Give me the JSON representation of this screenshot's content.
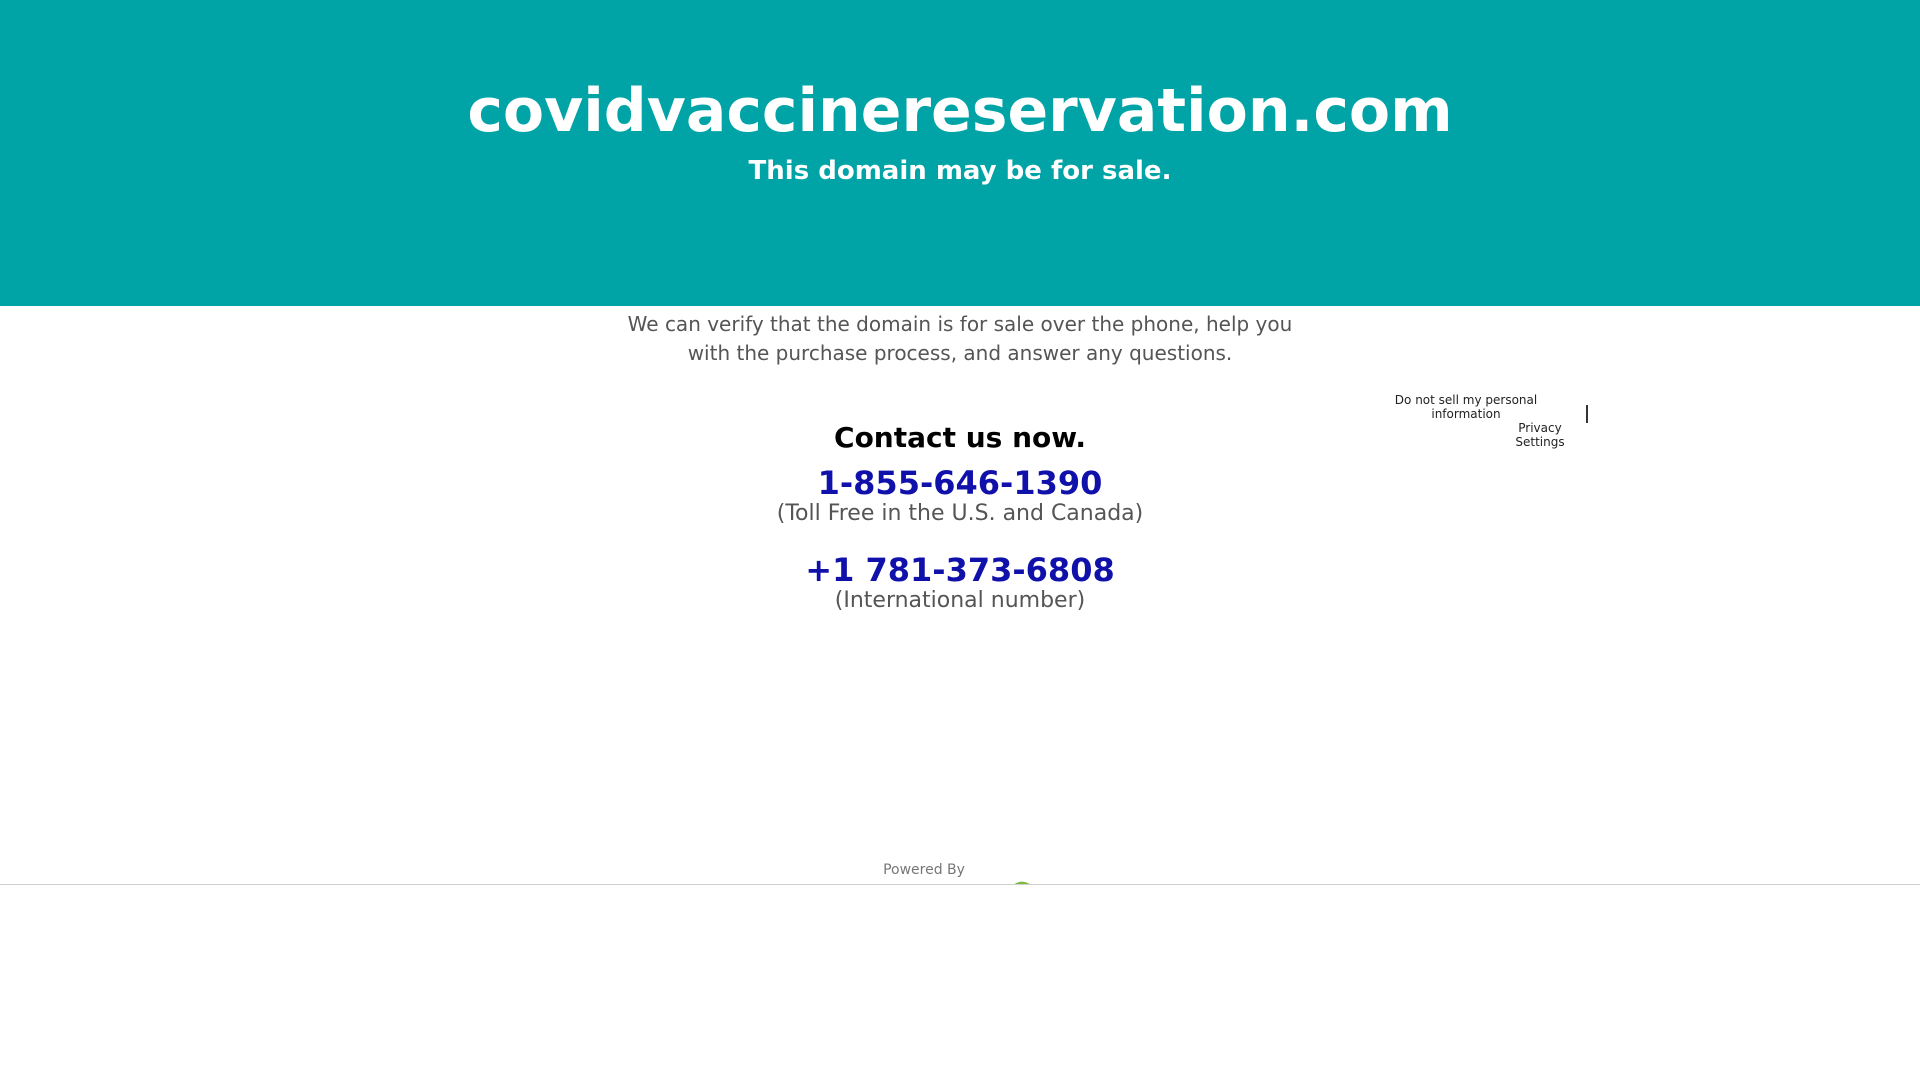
{
  "header": {
    "domain": "covidvaccinereservation.com",
    "subtitle": "This domain may be for sale."
  },
  "intro": {
    "text": "We can verify that the domain is for sale over the phone, help you with the purchase process, and answer any questions."
  },
  "contact": {
    "heading": "Contact us now.",
    "tollfree_number": "1-855-646-1390",
    "tollfree_note": "(Toll Free in the U.S. and Canada)",
    "intl_number": "+1 781-373-6808",
    "intl_note": "(International number)"
  },
  "privacy": {
    "do_not_sell": "Do not sell my personal information",
    "settings": "Privacy Settings"
  },
  "footer": {
    "powered_by": "Powered By",
    "logo_icon": "brand-logo-icon"
  },
  "colors": {
    "banner": "#00a4a6",
    "phone_link": "#1010aa",
    "body_text": "#555555"
  }
}
